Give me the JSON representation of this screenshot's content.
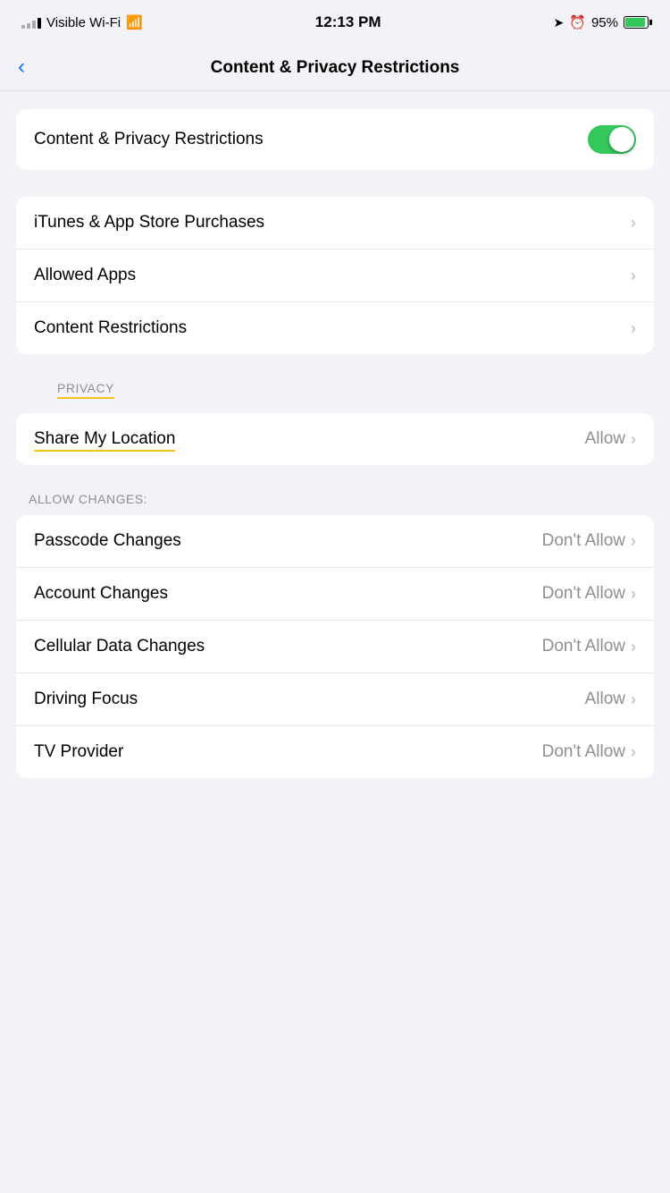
{
  "statusBar": {
    "carrier": "Visible Wi-Fi",
    "time": "12:13 PM",
    "battery": "95%"
  },
  "navBar": {
    "backLabel": "Back",
    "title": "Content & Privacy Restrictions"
  },
  "topToggle": {
    "label": "Content & Privacy Restrictions",
    "enabled": true
  },
  "menuItems": [
    {
      "label": "iTunes & App Store Purchases",
      "value": "",
      "showChevron": true
    },
    {
      "label": "Allowed Apps",
      "value": "",
      "showChevron": true
    },
    {
      "label": "Content Restrictions",
      "value": "",
      "showChevron": true
    }
  ],
  "privacySection": {
    "header": "PRIVACY",
    "items": [
      {
        "label": "Share My Location",
        "value": "Allow",
        "showChevron": true
      }
    ]
  },
  "allowChangesSection": {
    "header": "ALLOW CHANGES:",
    "items": [
      {
        "label": "Passcode Changes",
        "value": "Don't Allow",
        "showChevron": true
      },
      {
        "label": "Account Changes",
        "value": "Don't Allow",
        "showChevron": true
      },
      {
        "label": "Cellular Data Changes",
        "value": "Don't Allow",
        "showChevron": true
      },
      {
        "label": "Driving Focus",
        "value": "Allow",
        "showChevron": true
      },
      {
        "label": "TV Provider",
        "value": "Don't Allow",
        "showChevron": true
      }
    ]
  }
}
